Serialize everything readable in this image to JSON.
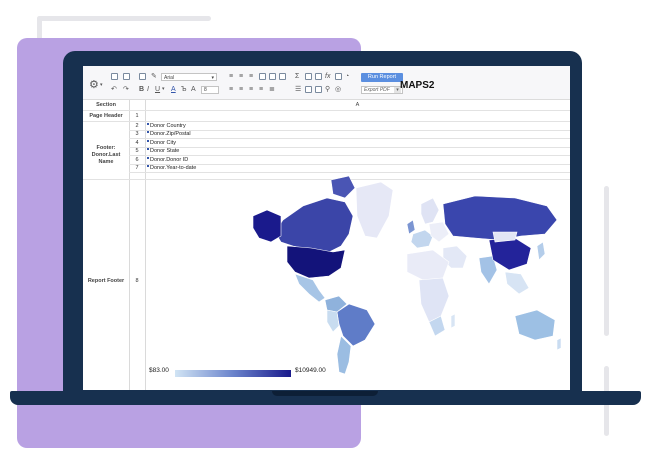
{
  "toolbar": {
    "font_name": "Arial",
    "font_size": "8",
    "run_report_label": "Run Report",
    "export_label": "Export PDF"
  },
  "sheet": {
    "section_header": "Section",
    "column_header": "A",
    "sections": [
      {
        "label": "Page Header"
      },
      {
        "label": "Footer: Donor.Last Name"
      },
      {
        "label": "Report Footer"
      }
    ],
    "rows": [
      {
        "num": "1",
        "text": ""
      },
      {
        "num": "2",
        "text": "Donor Country"
      },
      {
        "num": "3",
        "text": "Donor.Zip/Postal"
      },
      {
        "num": "4",
        "text": "Donor City"
      },
      {
        "num": "5",
        "text": "Donor State"
      },
      {
        "num": "6",
        "text": "Donor.Donor ID"
      },
      {
        "num": "7",
        "text": "Donor.Year-to-date"
      },
      {
        "num": "8",
        "text": ""
      }
    ],
    "report_title": "MAPS2"
  },
  "map": {
    "legend_min": "$83.00",
    "legend_max": "$10949.00",
    "color_low": "#d1e4f4",
    "color_high": "#1a1a8c"
  },
  "colors": {
    "laptop": "#17304f",
    "accent_card": "#b9a1e3",
    "run_button": "#5b8fe0"
  }
}
